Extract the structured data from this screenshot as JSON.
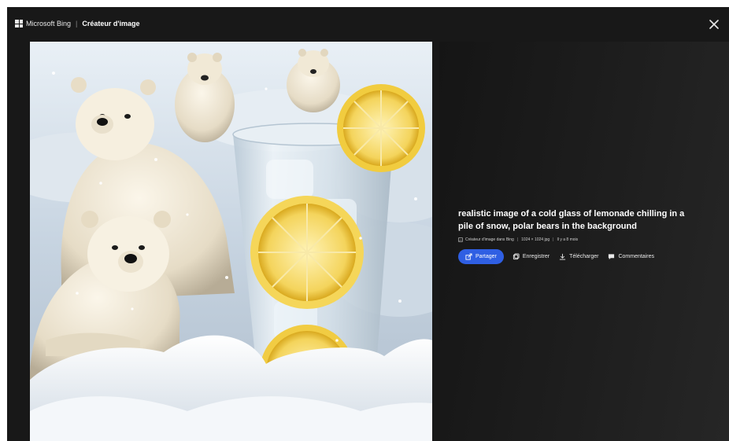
{
  "header": {
    "brand": "Microsoft Bing",
    "app_name": "Créateur d'image",
    "close_icon": "close-icon"
  },
  "image": {
    "description": "realistic image of a cold glass of lemonade chilling in a pile of snow, polar bears in the background"
  },
  "info": {
    "title": "realistic image of a cold glass of lemonade chilling in a pile of snow, polar bears in the background",
    "meta": {
      "source": "Créateur d'image dans Bing",
      "size": "1024 × 1024 jpg",
      "age": "Il y a 8 mois"
    }
  },
  "actions": {
    "share": "Partager",
    "save": "Enregistrer",
    "download": "Télécharger",
    "comments": "Commentaires"
  },
  "colors": {
    "background": "#181818",
    "accent": "#2f5fe3",
    "text": "#ffffff"
  }
}
